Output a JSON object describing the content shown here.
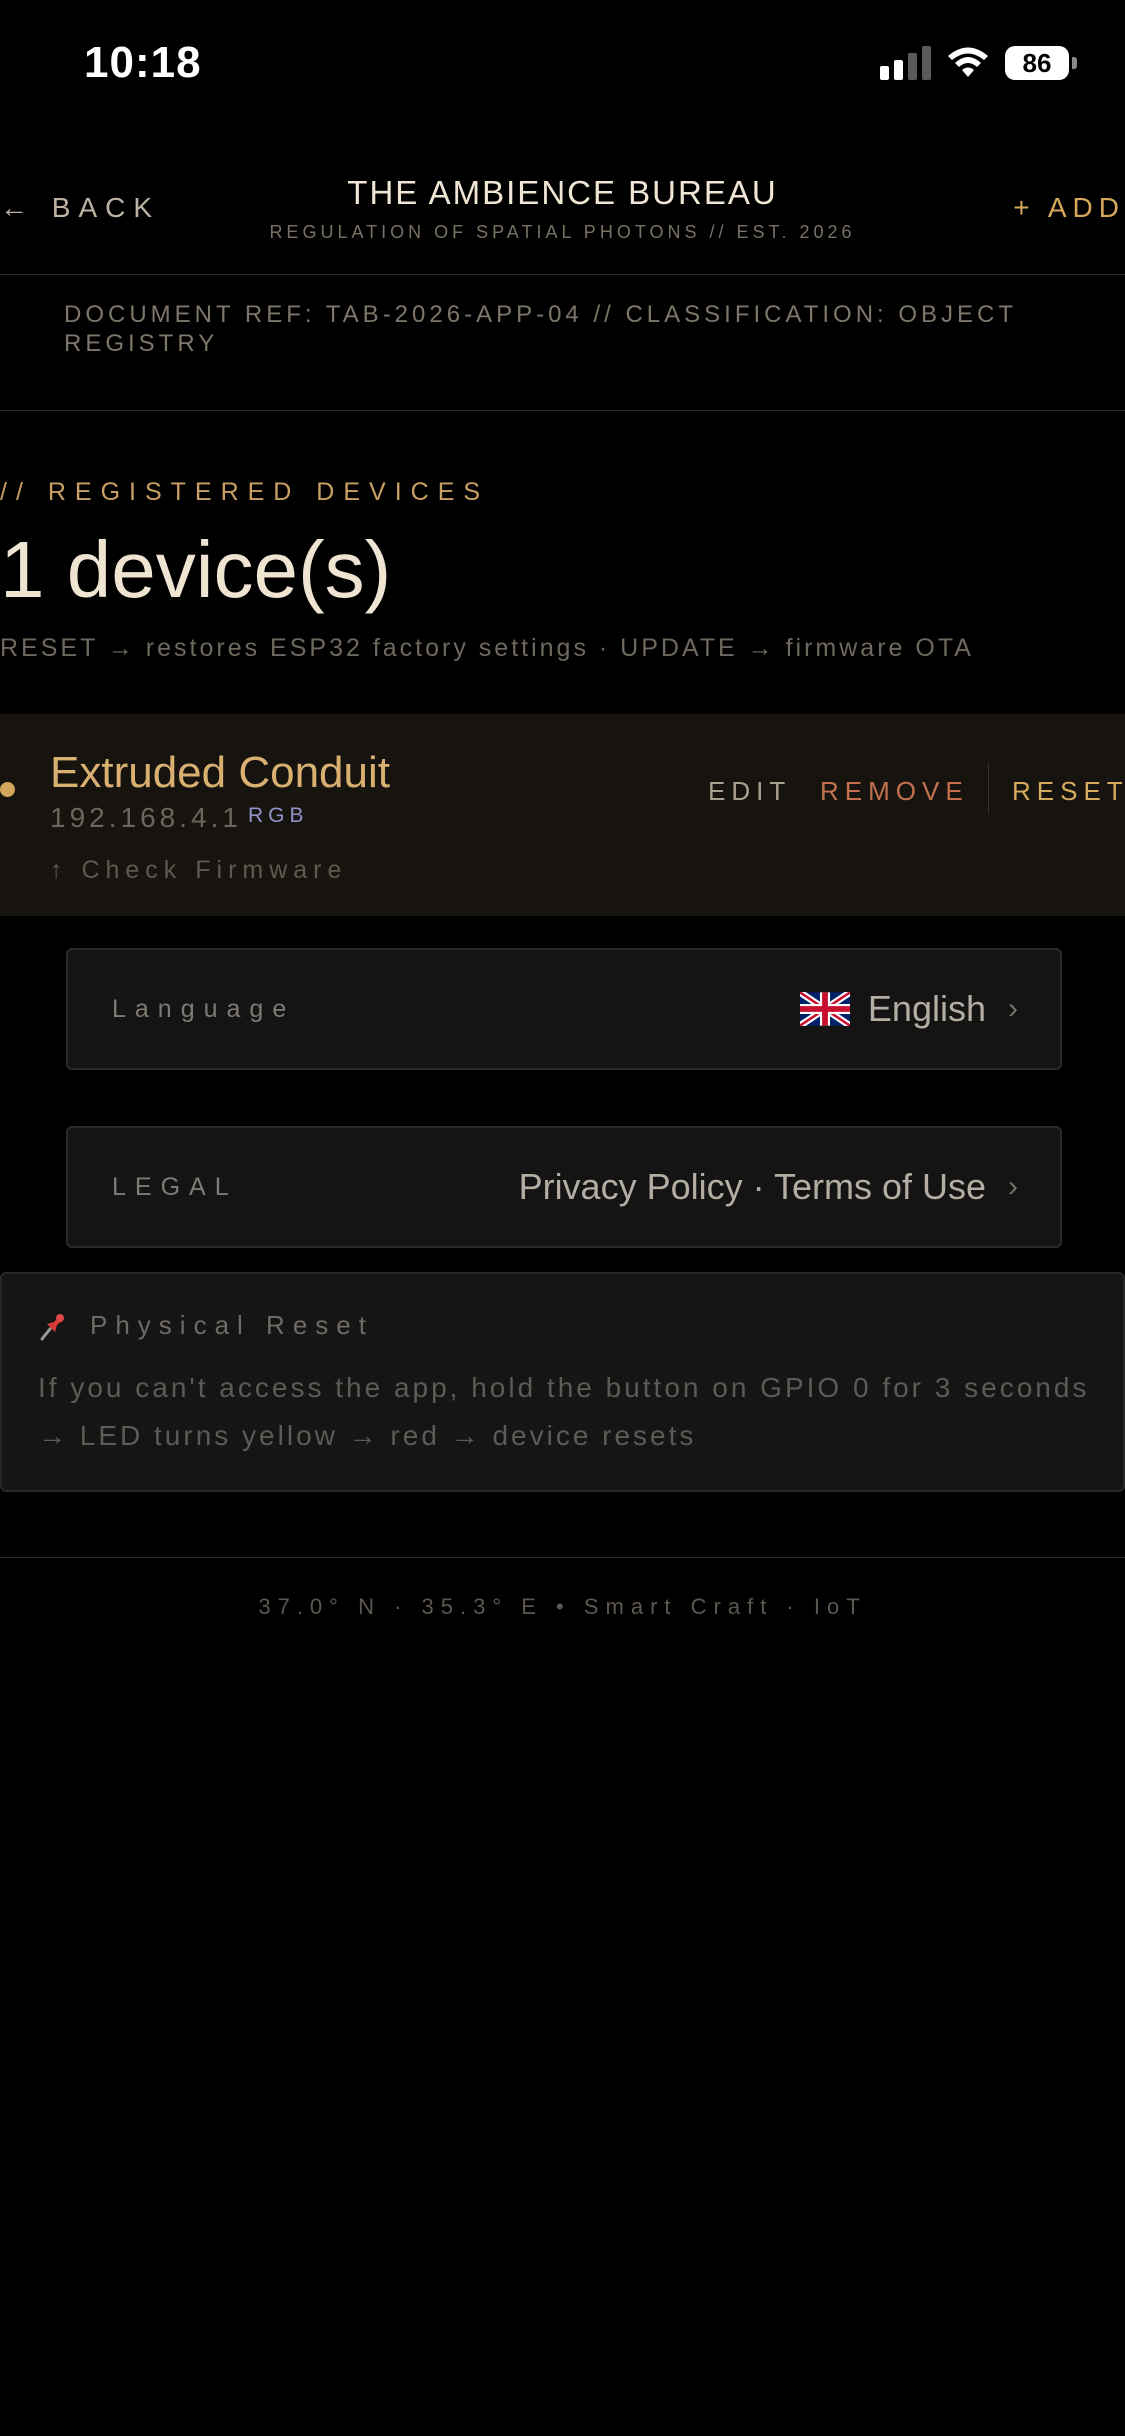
{
  "status_bar": {
    "time": "10:18",
    "battery": "86"
  },
  "header": {
    "back_label": "← BACK",
    "title": "THE AMBIENCE BUREAU",
    "subtitle": "REGULATION OF SPATIAL PHOTONS // EST. 2026",
    "add_label": "+ ADD"
  },
  "document_ref": "DOCUMENT REF: TAB-2026-APP-04 // CLASSIFICATION: OBJECT REGISTRY",
  "devices_section": {
    "label": "// REGISTERED DEVICES",
    "count_text": "1 device(s)",
    "hint": "RESET → restores ESP32 factory settings · UPDATE → firmware OTA"
  },
  "devices": [
    {
      "name": "Extruded Conduit",
      "ip": "192.168.4.1",
      "type": "RGB",
      "check_firmware": "↑ Check Firmware",
      "actions": {
        "edit": "EDIT",
        "remove": "REMOVE",
        "reset": "RESET"
      }
    }
  ],
  "settings": {
    "language": {
      "label": "Language",
      "value": "English"
    },
    "legal": {
      "label": "LEGAL",
      "value": "Privacy Policy · Terms of Use"
    }
  },
  "physical_reset": {
    "title": "Physical Reset",
    "text": "If you can't access the app, hold the button on GPIO 0 for 3 seconds → LED turns yellow → red → device resets"
  },
  "footer": "37.0° N · 35.3° E   •   Smart Craft · IoT",
  "colors": {
    "accent": "#d6a85a",
    "remove": "#c2714f",
    "type_badge": "#8f93c8",
    "background": "#000000"
  },
  "icons": [
    "signal-icon",
    "wifi-icon",
    "battery-icon",
    "uk-flag-icon",
    "chevron-right-icon",
    "pin-icon"
  ]
}
